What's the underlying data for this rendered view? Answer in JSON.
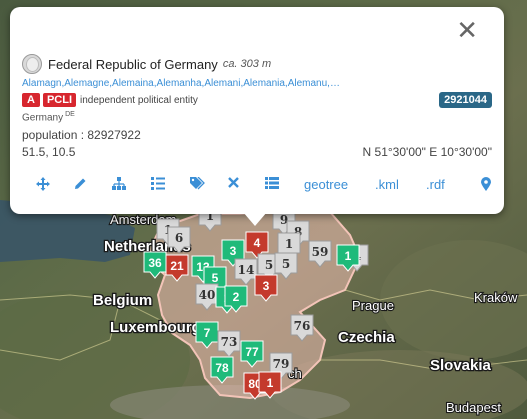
{
  "map": {
    "countries": [
      {
        "id": "netherlands",
        "label": "Netherlands"
      },
      {
        "id": "belgium",
        "label": "Belgium"
      },
      {
        "id": "luxembourg",
        "label": "Luxembourg"
      },
      {
        "id": "czechia",
        "label": "Czechia"
      },
      {
        "id": "slovakia",
        "label": "Slovakia"
      }
    ],
    "cities": [
      {
        "id": "amsterdam",
        "label": "Amsterdam"
      },
      {
        "id": "prague",
        "label": "Prague"
      },
      {
        "id": "krakow",
        "label": "Kraków"
      },
      {
        "id": "budapest",
        "label": "Budapest"
      },
      {
        "id": "munich-partial",
        "label": "ch"
      }
    ],
    "colors": {
      "green": "#1fba7a",
      "red": "#c43a2c",
      "grey": "#9b9b9b",
      "blue": "#3c4fb0",
      "highlight": "#f1c0b4"
    },
    "markers": [
      {
        "label": "1",
        "color": "grey"
      },
      {
        "label": "1",
        "color": "grey"
      },
      {
        "label": "6",
        "color": "grey"
      },
      {
        "label": "9",
        "color": "grey"
      },
      {
        "label": "8",
        "color": "grey"
      },
      {
        "label": "1",
        "color": "grey"
      },
      {
        "label": "59",
        "color": "grey"
      },
      {
        "label": "4",
        "color": "grey"
      },
      {
        "label": "1",
        "color": "green"
      },
      {
        "label": "3",
        "color": "green"
      },
      {
        "label": "4",
        "color": "red"
      },
      {
        "label": "36",
        "color": "green"
      },
      {
        "label": "21",
        "color": "red"
      },
      {
        "label": "13",
        "color": "green"
      },
      {
        "label": "5",
        "color": "green"
      },
      {
        "label": "14",
        "color": "grey"
      },
      {
        "label": "5",
        "color": "grey"
      },
      {
        "label": "5",
        "color": "grey"
      },
      {
        "label": "3",
        "color": "red"
      },
      {
        "label": "40",
        "color": "grey"
      },
      {
        "label": "1",
        "color": "green"
      },
      {
        "label": "2",
        "color": "green"
      },
      {
        "label": "7",
        "color": "green"
      },
      {
        "label": "73",
        "color": "grey"
      },
      {
        "label": "76",
        "color": "grey"
      },
      {
        "label": "77",
        "color": "green"
      },
      {
        "label": "79",
        "color": "grey"
      },
      {
        "label": "78",
        "color": "green"
      },
      {
        "label": "80",
        "color": "red"
      },
      {
        "label": "1",
        "color": "red"
      }
    ]
  },
  "popup": {
    "title": "Federal Republic of Germany",
    "elevation": "ca. 303 m",
    "alternate_names": "Alamagn,Alemagne,Alemaina,Alemanha,Alemani,Alemania,Alemanu,…",
    "feature_class": "A",
    "feature_code": "PCLI",
    "feature_desc": "independent political entity",
    "geoname_id": "2921044",
    "country": "Germany",
    "country_code": "DE",
    "population_label": "population : 82927922",
    "coords_decimal": "51.5, 10.5",
    "coords_dms": "N 51°30'00\" E 10°30'00\"",
    "close_icon": "close-icon",
    "toolbar": {
      "move_icon": "move-icon",
      "edit_icon": "pencil-icon",
      "hierarchy_icon": "hierarchy-icon",
      "list_icon": "ordered-list-icon",
      "tags_icon": "tags-icon",
      "remove_icon": "times-icon",
      "table_icon": "table-icon",
      "geotree": "geotree",
      "kml": ".kml",
      "rdf": ".rdf",
      "location_icon": "map-marker-icon"
    }
  }
}
